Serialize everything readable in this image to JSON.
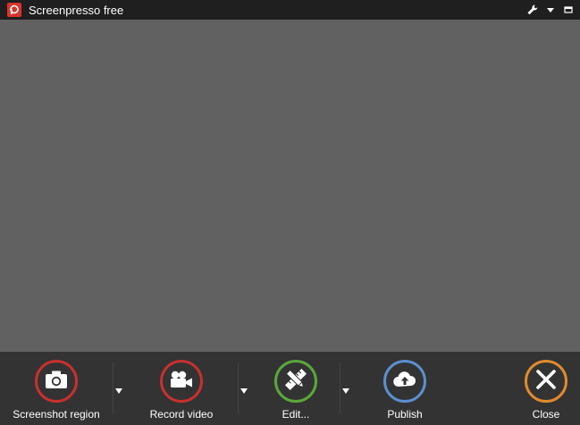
{
  "window": {
    "title": "Screenpresso free",
    "icons": [
      "app-logo-icon",
      "wrench-icon",
      "dropdown-arrow-icon",
      "maximize-icon"
    ]
  },
  "toolbar": {
    "items": [
      {
        "label": "Screenshot region",
        "icon": "camera-icon",
        "color": "#c8302f",
        "has_dropdown": true
      },
      {
        "label": "Record video",
        "icon": "video-camera-icon",
        "color": "#c8302f",
        "has_dropdown": true
      },
      {
        "label": "Edit...",
        "icon": "pencil-ruler-icon",
        "color": "#5aa83a",
        "has_dropdown": true
      },
      {
        "label": "Publish",
        "icon": "cloud-upload-icon",
        "color": "#5b8fd0",
        "has_dropdown": false
      },
      {
        "label": "Close",
        "icon": "close-x-icon",
        "color": "#e08b2c",
        "has_dropdown": false
      }
    ]
  },
  "colors": {
    "titlebar_bg": "#1f1f1f",
    "capture_area_bg": "#616161",
    "toolbar_bg": "#333333",
    "text": "#ffffff"
  }
}
